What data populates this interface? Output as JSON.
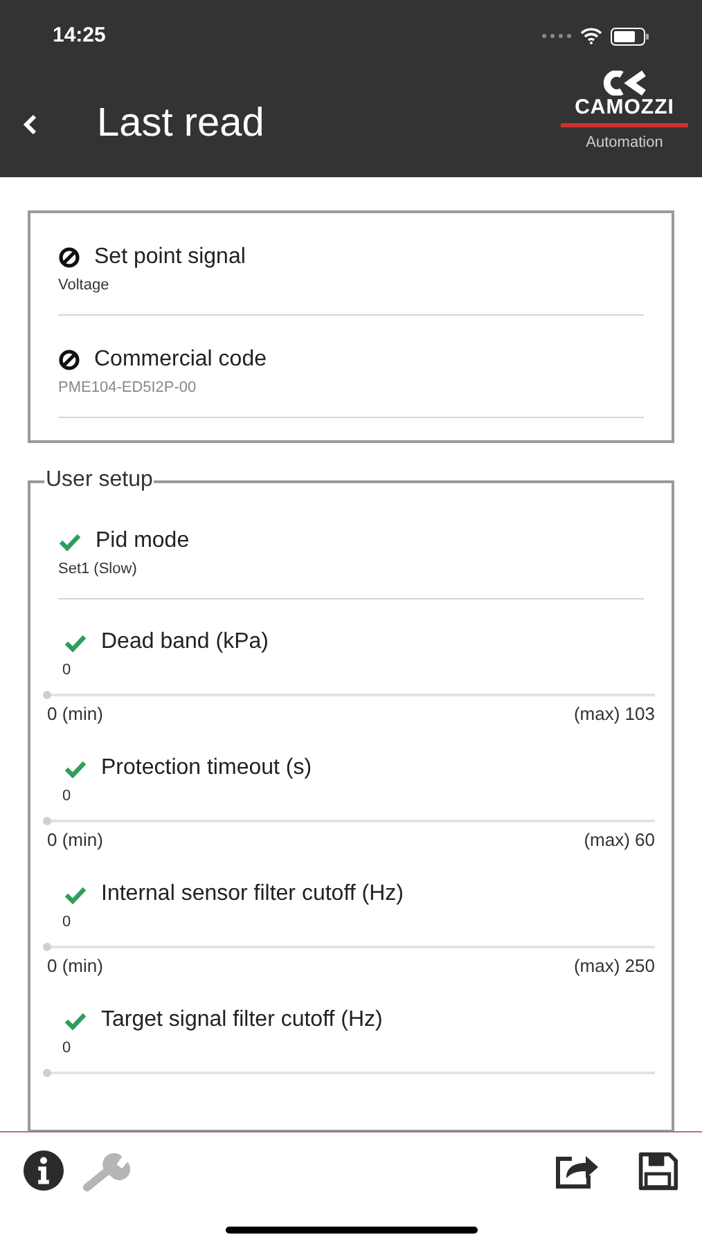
{
  "status_bar": {
    "time": "14:25"
  },
  "header": {
    "title": "Last read",
    "logo": {
      "name": "CAMOZZI",
      "tagline": "Automation"
    }
  },
  "info_card": {
    "items": [
      {
        "kind": "info",
        "valid": false,
        "label": "Set point signal",
        "value": "Voltage"
      },
      {
        "kind": "info",
        "valid": false,
        "label": "Commercial code",
        "value": "PME104-ED5I2P-00"
      }
    ]
  },
  "user_setup": {
    "title": "User setup",
    "items": [
      {
        "kind": "info",
        "valid": true,
        "label": "Pid mode",
        "value": "Set1 (Slow)"
      },
      {
        "kind": "slider",
        "valid": true,
        "label": "Dead band (kPa)",
        "value": "0",
        "level": 0,
        "min": "0 (min)",
        "max": "(max) 103"
      },
      {
        "kind": "slider",
        "valid": true,
        "label": "Protection timeout (s)",
        "value": "0",
        "level": 0,
        "min": "0 (min)",
        "max": "(max) 60"
      },
      {
        "kind": "slider",
        "valid": true,
        "label": "Internal sensor filter cutoff (Hz)",
        "value": "0",
        "level": 0,
        "min": "0 (min)",
        "max": "(max) 250"
      },
      {
        "kind": "slider",
        "valid": true,
        "label": "Target signal filter cutoff (Hz)",
        "value": "0",
        "level": 0
      }
    ]
  },
  "toolbar": {
    "wrench_disabled": true
  }
}
